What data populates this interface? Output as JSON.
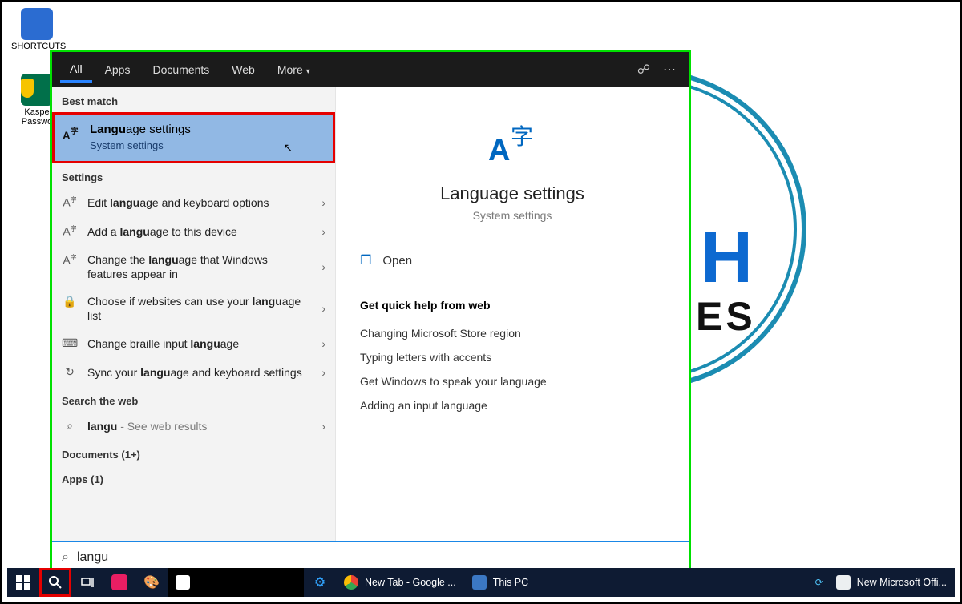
{
  "desktop": {
    "shortcuts": [
      {
        "label": "SHORTCUTS"
      },
      {
        "label": "Kaspe\nPasswo"
      }
    ]
  },
  "search": {
    "tabs": {
      "all": "All",
      "apps": "Apps",
      "documents": "Documents",
      "web": "Web",
      "more": "More"
    },
    "best_match_header": "Best match",
    "best_match": {
      "title_bold": "Langu",
      "title_rest": "age settings",
      "subtitle": "System settings"
    },
    "settings_header": "Settings",
    "settings_items": [
      {
        "icon": "A字",
        "pre": "Edit ",
        "bold": "langu",
        "post": "age and keyboard options"
      },
      {
        "icon": "A字",
        "pre": "Add a ",
        "bold": "langu",
        "post": "age to this device"
      },
      {
        "icon": "A字",
        "pre": "Change the ",
        "bold": "langu",
        "post": "age that Windows features appear in"
      },
      {
        "icon": "🔒",
        "pre": "Choose if websites can use your ",
        "bold": "langu",
        "post": "age list"
      },
      {
        "icon": "⌨",
        "pre": "Change braille input ",
        "bold": "langu",
        "post": "age"
      },
      {
        "icon": "↻",
        "pre": "Sync your ",
        "bold": "langu",
        "post": "age and keyboard settings"
      }
    ],
    "web_header": "Search the web",
    "web_item": {
      "icon": "⌕",
      "bold": "langu",
      "muted": " - See web results"
    },
    "documents_header": "Documents (1+)",
    "apps_header": "Apps (1)",
    "query": "langu"
  },
  "details": {
    "title": "Language settings",
    "subtitle": "System settings",
    "open": "Open",
    "quick_help_header": "Get quick help from web",
    "quick_links": [
      "Changing Microsoft Store region",
      "Typing letters with accents",
      "Get Windows to speak your language",
      "Adding an input language"
    ]
  },
  "taskbar": {
    "items": [
      {
        "label": "New Tab - Google ...",
        "color": "#fff"
      },
      {
        "label": "This PC",
        "color": "#fff"
      },
      {
        "label": "New Microsoft Offi...",
        "color": "#fff"
      }
    ]
  }
}
